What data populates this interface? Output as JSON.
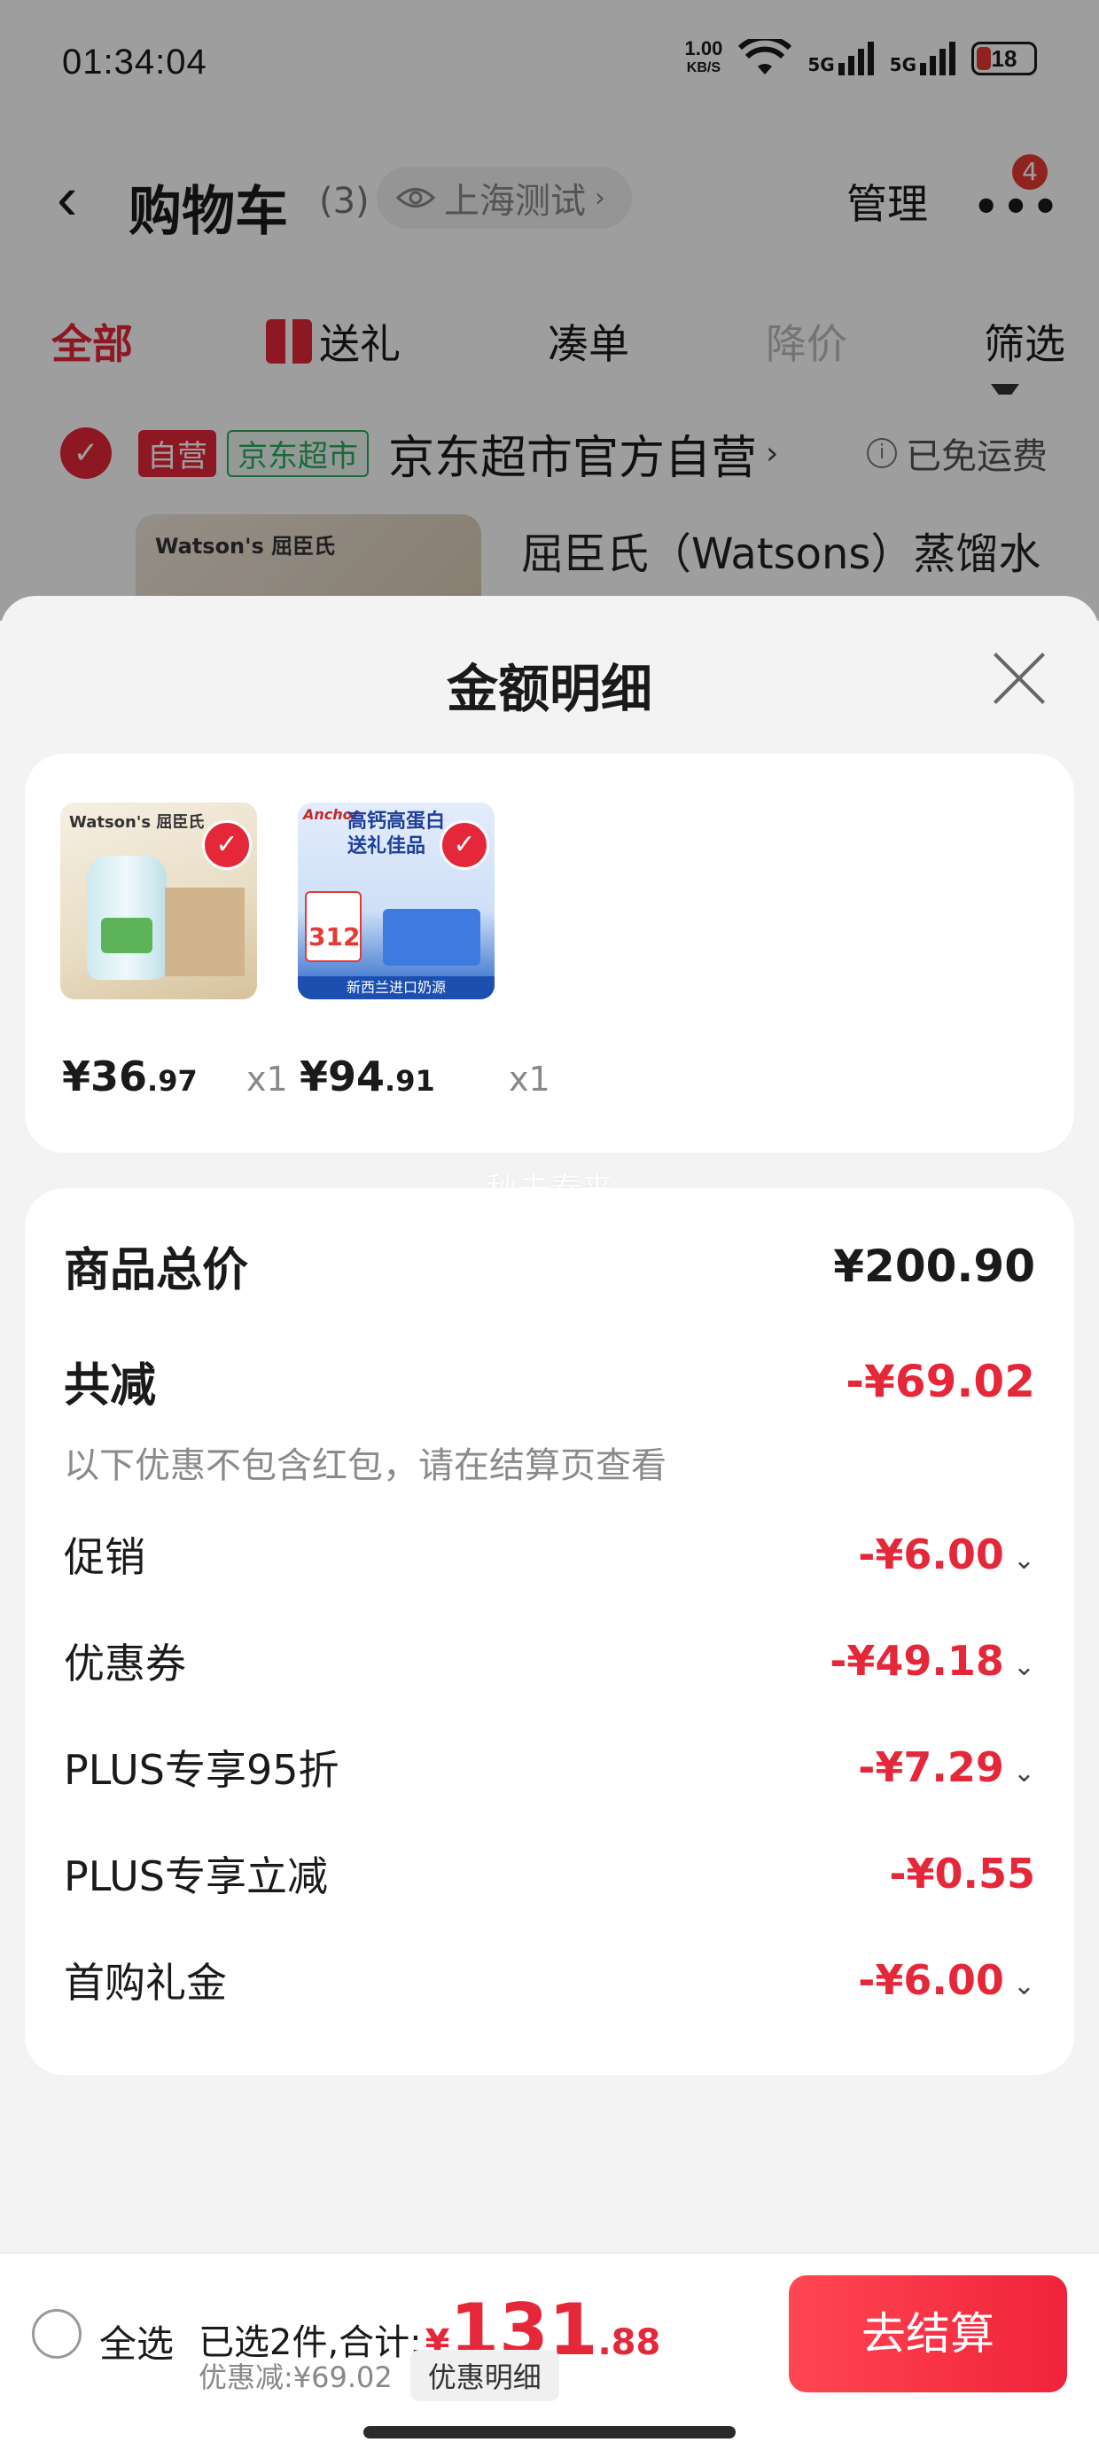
{
  "status_bar": {
    "time": "01:34:04",
    "net_speed_value": "1.00",
    "net_speed_unit": "KB/S",
    "signal1_label": "5G",
    "signal2_label": "5G",
    "battery": "18"
  },
  "header": {
    "back_icon": "chevron-left-icon",
    "title": "购物车",
    "count": "(3)",
    "location": "上海测试",
    "manage": "管理",
    "more_badge": "4"
  },
  "filter_tabs": [
    {
      "label": "全部"
    },
    {
      "label": "送礼"
    },
    {
      "label": "凑单"
    },
    {
      "label": "降价"
    },
    {
      "label": "筛选"
    }
  ],
  "store": {
    "tag_self": "自营",
    "tag_jd": "京东超市",
    "name": "京东超市官方自营",
    "free_shipping": "已免运费",
    "product_brand": "Watson's 屈臣氏",
    "product_name": "屈臣氏（Watsons）蒸馏水"
  },
  "sheet": {
    "title": "金额明细",
    "watermark": "秋去春来",
    "items": [
      {
        "brand": "Watson's 屈臣氏",
        "price_main": "¥36",
        "price_cents": ".97",
        "qty": "x1"
      },
      {
        "headline1": "高钙高蛋白",
        "headline2": "送礼佳品",
        "logo": "Anchor",
        "promo": "312",
        "footer": "新西兰进口奶源",
        "price_main": "¥94",
        "price_cents": ".91",
        "qty": "x1"
      }
    ],
    "total_label": "商品总价",
    "total_value": "¥200.90",
    "reduce_label": "共减",
    "reduce_value": "-¥69.02",
    "reduce_note": "以下优惠不包含红包，请在结算页查看",
    "discounts": [
      {
        "label": "促销",
        "value": "-¥6.00"
      },
      {
        "label": "优惠券",
        "value": "-¥49.18"
      },
      {
        "label": "PLUS专享95折",
        "value": "-¥7.29"
      },
      {
        "label": "PLUS专享立减",
        "value": "-¥0.55"
      },
      {
        "label": "首购礼金",
        "value": "-¥6.00"
      }
    ]
  },
  "bottom_bar": {
    "select_all": "全选",
    "summary_prefix": "已选2件,合计:",
    "currency": "¥",
    "amount_main": "131",
    "amount_cents": ".88",
    "discount_text": "优惠减:¥69.02",
    "detail_button": "优惠明细",
    "checkout": "去结算"
  },
  "colors": {
    "accent": "#e4283a",
    "jd_green": "#2eaa60"
  }
}
